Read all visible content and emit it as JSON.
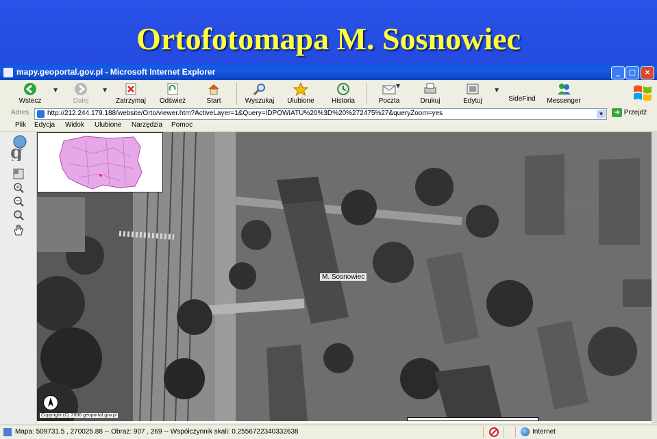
{
  "slide": {
    "title": "Ortofotomapa M. Sosnowiec"
  },
  "window": {
    "title": "mapy.geoportal.gov.pl - Microsoft Internet Explorer"
  },
  "toolbar": {
    "back": "Wstecz",
    "forward": "Dalej",
    "stop": "Zatrzymaj",
    "refresh": "Odśwież",
    "home": "Start",
    "search": "Wyszukaj",
    "favorites": "Ulubione",
    "history": "Historia",
    "mail": "Poczta",
    "print": "Drukuj",
    "edit": "Edytuj",
    "sidefind": "SideFind",
    "messenger": "Messenger"
  },
  "address": {
    "label": "Adres",
    "url": "http://212.244.179.188/website/Orto/viewer.htm?ActiveLayer=1&Query=IDPOWIATU%20%3D%20%272475%27&queryZoom=yes",
    "go": "Przejdź"
  },
  "menu": [
    "Plik",
    "Edycja",
    "Widok",
    "Ulubione",
    "Narzędzia",
    "Pomoc"
  ],
  "map": {
    "label": "M. Sosnowiec",
    "copyright": "Copyright (C) 2006 geoportal.gov.pl",
    "overview_region": "Poland",
    "tools": [
      "globe-logo",
      "layers-icon",
      "zoom-in-icon",
      "zoom-out-icon",
      "zoom-full-icon",
      "pan-hand-icon"
    ]
  },
  "status": {
    "text": "Mapa: 509731.5 , 270025.88 -- Obraz: 907 , 269 -- Współczynnik skali: 0.2556722340332638",
    "zone": "Internet"
  }
}
